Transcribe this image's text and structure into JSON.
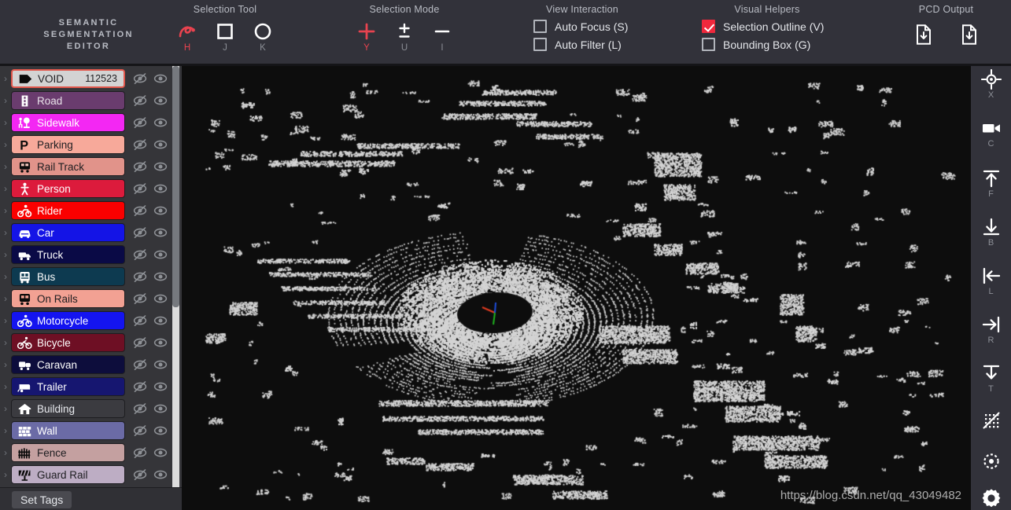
{
  "brand": {
    "line1": "SEMANTIC",
    "line2": "SEGMENTATION",
    "line3": "EDITOR"
  },
  "toolbar": {
    "groups": [
      {
        "title": "Selection Tool",
        "items": [
          {
            "icon": "lasso-icon",
            "key": "H",
            "active": true
          },
          {
            "icon": "rectangle-icon",
            "key": "J",
            "active": false
          },
          {
            "icon": "circle-icon",
            "key": "K",
            "active": false
          }
        ]
      },
      {
        "title": "Selection Mode",
        "items": [
          {
            "icon": "plus-icon",
            "key": "Y",
            "active": true
          },
          {
            "icon": "plus-minus-icon",
            "key": "U",
            "active": false
          },
          {
            "icon": "minus-icon",
            "key": "I",
            "active": false
          }
        ]
      }
    ],
    "view_interaction": {
      "title": "View Interaction",
      "items": [
        {
          "label": "Auto Focus (S)",
          "checked": false,
          "name": "auto-focus"
        },
        {
          "label": "Auto Filter (L)",
          "checked": false,
          "name": "auto-filter"
        }
      ]
    },
    "visual_helpers": {
      "title": "Visual Helpers",
      "items": [
        {
          "label": "Selection Outline (V)",
          "checked": true,
          "name": "selection-outline"
        },
        {
          "label": "Bounding Box (G)",
          "checked": false,
          "name": "bounding-box"
        }
      ]
    },
    "pcd_output": {
      "title": "PCD Output",
      "buttons": [
        {
          "icon": "file-download-icon",
          "name": "pcd-save-button"
        },
        {
          "icon": "file-download-icon",
          "name": "pcd-export-button"
        }
      ]
    }
  },
  "accent_color": "#f0283c",
  "sidebar": {
    "classes": [
      {
        "label": "VOID",
        "count": "112523",
        "bg": "#d3d3d3",
        "fg": "#1d1d20",
        "icon": "void-tag-icon",
        "iconColor": "#0a0a0a",
        "selected": true
      },
      {
        "label": "Road",
        "count": "",
        "bg": "#6a3c6e",
        "fg": "#e9e3ea",
        "icon": "road-icon",
        "iconColor": "#ffffff",
        "selected": false
      },
      {
        "label": "Sidewalk",
        "count": "",
        "bg": "#f327f3",
        "fg": "#ffffff",
        "icon": "sidewalk-icon",
        "iconColor": "#ffffff",
        "selected": false
      },
      {
        "label": "Parking",
        "count": "",
        "bg": "#f7a99a",
        "fg": "#1d1d20",
        "icon": "parking-icon",
        "iconColor": "#0a0a0a",
        "selected": false
      },
      {
        "label": "Rail Track",
        "count": "",
        "bg": "#e1938a",
        "fg": "#1d1d20",
        "icon": "rail-track-icon",
        "iconColor": "#0a0a0a",
        "selected": false
      },
      {
        "label": "Person",
        "count": "",
        "bg": "#dc1b3c",
        "fg": "#ffffff",
        "icon": "person-icon",
        "iconColor": "#ffffff",
        "selected": false
      },
      {
        "label": "Rider",
        "count": "",
        "bg": "#fa0000",
        "fg": "#ffffff",
        "icon": "rider-icon",
        "iconColor": "#ffffff",
        "selected": false
      },
      {
        "label": "Car",
        "count": "",
        "bg": "#1414e6",
        "fg": "#ffffff",
        "icon": "car-icon",
        "iconColor": "#ffffff",
        "selected": false
      },
      {
        "label": "Truck",
        "count": "",
        "bg": "#0a0a46",
        "fg": "#ffffff",
        "icon": "truck-icon",
        "iconColor": "#ffffff",
        "selected": false
      },
      {
        "label": "Bus",
        "count": "",
        "bg": "#0d3a50",
        "fg": "#ffffff",
        "icon": "bus-icon",
        "iconColor": "#ffffff",
        "selected": false
      },
      {
        "label": "On Rails",
        "count": "",
        "bg": "#f2a193",
        "fg": "#1d1d20",
        "icon": "on-rails-icon",
        "iconColor": "#0a0a0a",
        "selected": false
      },
      {
        "label": "Motorcycle",
        "count": "",
        "bg": "#1414f0",
        "fg": "#ffffff",
        "icon": "motorcycle-icon",
        "iconColor": "#ffffff",
        "selected": false
      },
      {
        "label": "Bicycle",
        "count": "",
        "bg": "#6e0f24",
        "fg": "#ffffff",
        "icon": "bicycle-icon",
        "iconColor": "#ffffff",
        "selected": false
      },
      {
        "label": "Caravan",
        "count": "",
        "bg": "#0d0d3c",
        "fg": "#ffffff",
        "icon": "caravan-icon",
        "iconColor": "#ffffff",
        "selected": false
      },
      {
        "label": "Trailer",
        "count": "",
        "bg": "#161670",
        "fg": "#ffffff",
        "icon": "trailer-icon",
        "iconColor": "#ffffff",
        "selected": false
      },
      {
        "label": "Building",
        "count": "",
        "bg": "#3b3b40",
        "fg": "#e8eaee",
        "icon": "building-icon",
        "iconColor": "#ffffff",
        "selected": false
      },
      {
        "label": "Wall",
        "count": "",
        "bg": "#6b6ba6",
        "fg": "#ffffff",
        "icon": "wall-icon",
        "iconColor": "#ffffff",
        "selected": false
      },
      {
        "label": "Fence",
        "count": "",
        "bg": "#c4a0a0",
        "fg": "#1d1d20",
        "icon": "fence-icon",
        "iconColor": "#0a0a0a",
        "selected": false
      },
      {
        "label": "Guard Rail",
        "count": "",
        "bg": "#bdadc4",
        "fg": "#1d1d20",
        "icon": "guard-rail-icon",
        "iconColor": "#0a0a0a",
        "selected": false
      }
    ],
    "row_actions": [
      {
        "icon": "eye-off-icon",
        "name": "hide-class-button"
      },
      {
        "icon": "eye-icon",
        "name": "isolate-class-button"
      }
    ],
    "expand_caret": "›",
    "set_tags_label": "Set Tags"
  },
  "rail": {
    "items": [
      {
        "icon": "crosshair-icon",
        "key": "X",
        "name": "rail-center-view"
      },
      {
        "icon": "camera-icon",
        "key": "C",
        "name": "rail-camera-view"
      },
      {
        "icon": "arrow-up-bar-icon",
        "key": "F",
        "name": "rail-front-view"
      },
      {
        "icon": "arrow-down-bar-icon",
        "key": "B",
        "name": "rail-back-view"
      },
      {
        "icon": "arrow-left-bar-icon",
        "key": "L",
        "name": "rail-left-view"
      },
      {
        "icon": "arrow-right-bar-icon",
        "key": "R",
        "name": "rail-right-view"
      },
      {
        "icon": "arrow-down-t-icon",
        "key": "T",
        "name": "rail-top-view"
      },
      {
        "icon": "points-off-icon",
        "key": "",
        "name": "rail-toggle-points"
      },
      {
        "icon": "dotted-circle-icon",
        "key": "",
        "name": "rail-toggle-focus"
      }
    ],
    "settings": {
      "icon": "gear-icon",
      "name": "settings-button"
    }
  },
  "viewport": {
    "watermark": "https://blog.csdn.net/qq_43049482",
    "background": "#0d0d0d",
    "point_color": "#d4d4d4",
    "axis_colors": {
      "x": "#e03b20",
      "y": "#1fb41f",
      "z": "#1f4fe0"
    }
  }
}
